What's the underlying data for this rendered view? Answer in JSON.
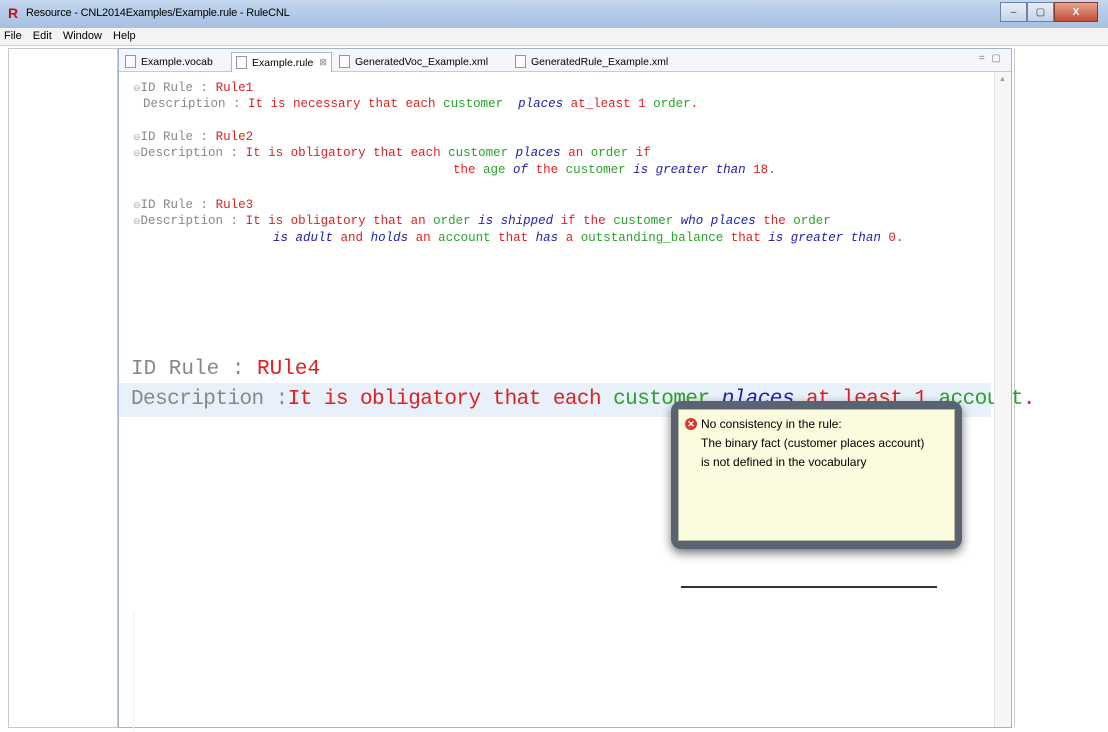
{
  "window": {
    "app_icon": "R",
    "title": "Resource - CNL2014Examples/Example.rule - RuleCNL",
    "buttons": [
      "–",
      "▢",
      "X"
    ]
  },
  "menu": [
    "File",
    "Edit",
    "Window",
    "Help"
  ],
  "tabs": [
    {
      "label": "Example.vocab"
    },
    {
      "label": "Example.rule",
      "close": "⊠"
    },
    {
      "label": "GeneratedVoc_Example.xml"
    },
    {
      "label": "GeneratedRule_Example.xml"
    }
  ],
  "panel_controls": "= ▢",
  "rules": {
    "r1": {
      "id_label": "ID Rule : ",
      "id": "Rule1",
      "desc_label": "Description : ",
      "d1": "It is necessary that each ",
      "d2": "customer",
      "d3": "places",
      "d4": "at_least 1 ",
      "d5": "order",
      "d6": "."
    },
    "r2": {
      "id_label": "ID Rule : ",
      "id": "Rule2",
      "desc_label": "Description : ",
      "a1": "It is obligatory that each ",
      "a2": "customer",
      "a3": "places",
      "a4": "an ",
      "a5": "order",
      "a6": "if",
      "b1": "the ",
      "b2": "age",
      "b3": "of",
      "b4": "the ",
      "b5": "customer",
      "b6": "is greater than",
      "b7": "18."
    },
    "r3": {
      "id_label": "ID Rule : ",
      "id": "Rule3",
      "desc_label": "Description : ",
      "a1": "It is obligatory that an ",
      "a2": "order",
      "a3": "is shipped",
      "a4": "if the ",
      "a5": "customer",
      "a6": "who",
      "a7": "places",
      "a8": "the ",
      "a9": "order",
      "b1": "is adult",
      "b2": "and",
      "b3": "holds",
      "b4": "an ",
      "b5": "account",
      "b6": "that",
      "b7": "has",
      "b8": "a ",
      "b9": "outstanding_balance",
      "b10": "that",
      "b11": "is greater than",
      "b12": "0."
    },
    "r4": {
      "id_label": "ID Rule : ",
      "id": "RUle4",
      "desc_label": "Description :",
      "d1": "It is obligatory that each ",
      "d2": "customer",
      "d3": "places",
      "d4": "at least 1 ",
      "d5": "account",
      "d6": "."
    }
  },
  "tooltip": {
    "icon": "error-icon",
    "line1": "No consistency in the rule:",
    "line2": "The binary fact (customer places account)",
    "line3": "is not defined in the vocabulary"
  },
  "colors": {
    "keyword_red": "#e02020",
    "term_green": "#2aa22a",
    "verb_blue": "#2222aa",
    "tooltip_bg": "#fbfbdf"
  }
}
